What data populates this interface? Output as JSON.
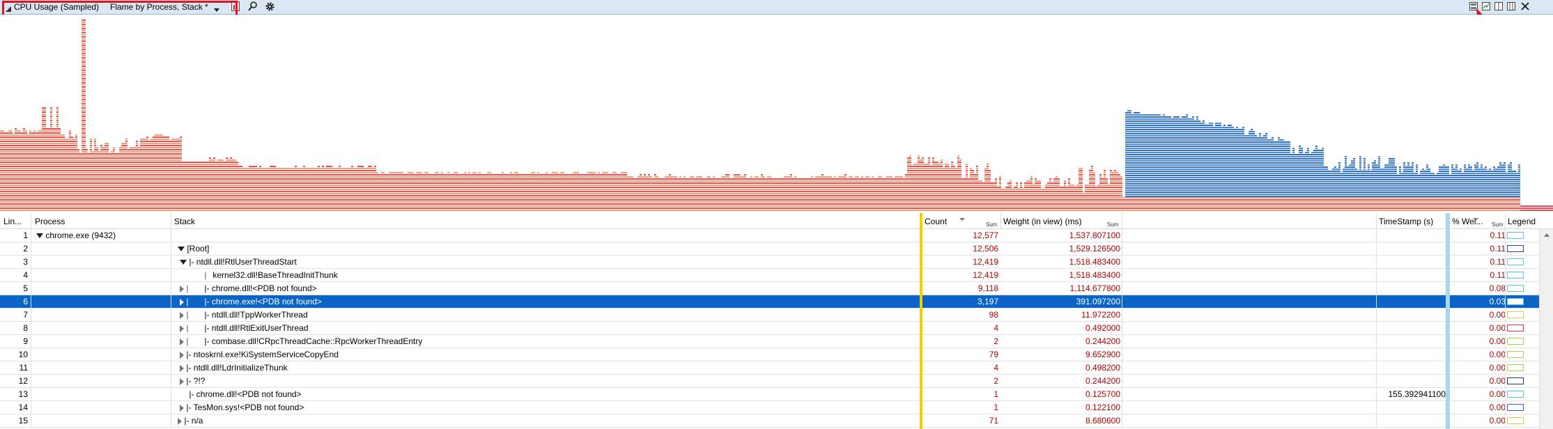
{
  "titlebar": {
    "graph_name": "CPU Usage (Sampled)",
    "preset": "Flame by Process, Stack *",
    "icons": [
      "expand-triangle-icon",
      "chart-type-icon",
      "search-icon",
      "settings-gear-icon"
    ],
    "right_icons": [
      "graph-only-icon",
      "graph-and-table-icon",
      "table-only-icon",
      "split-view-icon",
      "close-icon"
    ]
  },
  "columns": {
    "line": "Lin...",
    "process": "Process",
    "stack": "Stack",
    "count": "Count",
    "count_sum": "Sum",
    "weight": "Weight (in view) (ms)",
    "weight_sum": "Sum",
    "timestamp": "TimeStamp (s)",
    "pct_weight": "% Wei...",
    "pct_sum": "Sum",
    "legend": "Legend"
  },
  "rows": [
    {
      "line": "1",
      "process": "chrome.exe (9432)",
      "stack": "",
      "count": "12,577",
      "weight": "1,537.807100",
      "ts": "",
      "pct": "0.11",
      "legend": "#55c8e6"
    },
    {
      "line": "2",
      "process": "",
      "stack": "[Root]",
      "count": "12,506",
      "weight": "1,529.126500",
      "ts": "",
      "pct": "0.11",
      "legend": "#1e46b4"
    },
    {
      "line": "3",
      "process": "",
      "stack": "|- ntdll.dll!RtlUserThreadStart",
      "count": "12,419",
      "weight": "1,518.483400",
      "ts": "",
      "pct": "0.11",
      "legend": "#55c8e6"
    },
    {
      "line": "4",
      "process": "",
      "stack": "kernel32.dll!BaseThreadInitThunk",
      "count": "12,419",
      "weight": "1,518.483400",
      "ts": "",
      "pct": "0.11",
      "legend": "#55c8e6"
    },
    {
      "line": "5",
      "process": "",
      "stack": "|- chrome.dll!<PDB not found>",
      "count": "9,118",
      "weight": "1,114.677800",
      "ts": "",
      "pct": "0.08",
      "legend": "#55c8e6"
    },
    {
      "line": "6",
      "process": "",
      "stack": "|- chrome.exe!<PDB not found>",
      "count": "3,197",
      "weight": "391.097200",
      "ts": "",
      "pct": "0.03",
      "legend": "#55c8e6"
    },
    {
      "line": "7",
      "process": "",
      "stack": "|- ntdll.dll!TppWorkerThread",
      "count": "98",
      "weight": "11.972200",
      "ts": "",
      "pct": "0.00",
      "legend": "#d2d246"
    },
    {
      "line": "8",
      "process": "",
      "stack": "|- ntdll.dll!RtlExitUserThread",
      "count": "4",
      "weight": "0.492000",
      "ts": "",
      "pct": "0.00",
      "legend": "#dc3232"
    },
    {
      "line": "9",
      "process": "",
      "stack": "|- combase.dll!CRpcThreadCache::RpcWorkerThreadEntry",
      "count": "2",
      "weight": "0.244200",
      "ts": "",
      "pct": "0.00",
      "legend": "#aad250"
    },
    {
      "line": "10",
      "process": "",
      "stack": "|- ntoskrnl.exe!KiSystemServiceCopyEnd",
      "count": "79",
      "weight": "9.652900",
      "ts": "",
      "pct": "0.00",
      "legend": "#aad250"
    },
    {
      "line": "11",
      "process": "",
      "stack": "|- ntdll.dll!LdrInitializeThunk",
      "count": "4",
      "weight": "0.498200",
      "ts": "",
      "pct": "0.00",
      "legend": "#aad250"
    },
    {
      "line": "12",
      "process": "",
      "stack": "|- ?!?",
      "count": "2",
      "weight": "0.244200",
      "ts": "",
      "pct": "0.00",
      "legend": "#1e3296"
    },
    {
      "line": "13",
      "process": "",
      "stack": "|- chrome.dll!<PDB not found>",
      "count": "1",
      "weight": "0.125700",
      "ts": "155.392941100",
      "pct": "0.00",
      "legend": "#55c8e6"
    },
    {
      "line": "14",
      "process": "",
      "stack": "|- TesMon.sys!<PDB not found>",
      "count": "1",
      "weight": "0.122100",
      "ts": "",
      "pct": "0.00",
      "legend": "#2864d2"
    },
    {
      "line": "15",
      "process": "",
      "stack": "|- n/a",
      "count": "71",
      "weight": "8.680600",
      "ts": "",
      "pct": "0.00",
      "legend": "#d2d246"
    }
  ],
  "selected_row": "6"
}
